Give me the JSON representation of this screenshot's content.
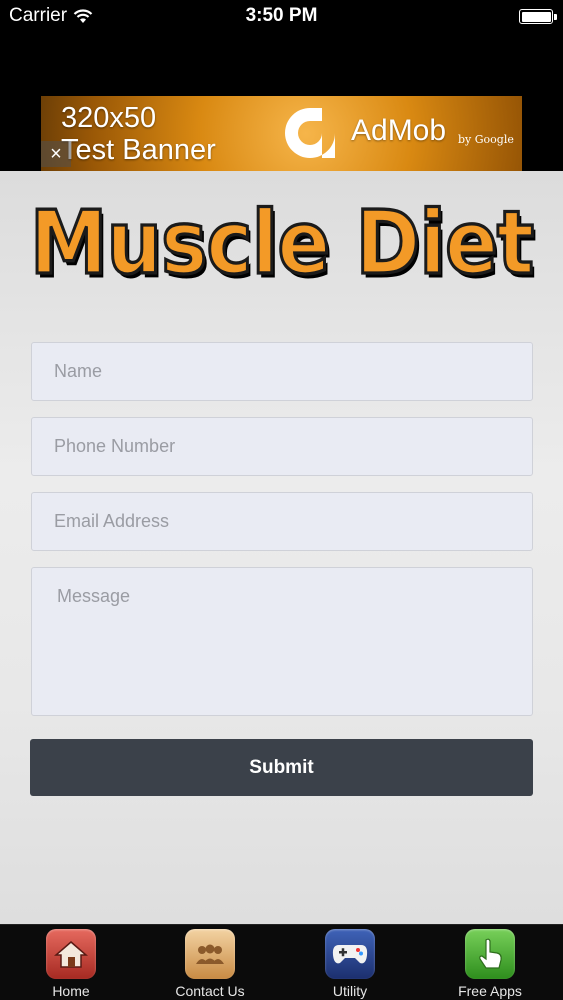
{
  "status_bar": {
    "carrier": "Carrier",
    "time": "3:50 PM",
    "battery_level": 1.0
  },
  "ad_banner": {
    "size_line1": "320x50",
    "size_line2": "Test Banner",
    "close_symbol": "×",
    "brand": "AdMob",
    "by": "by Google"
  },
  "app": {
    "logo_text": "Muscle Diet"
  },
  "form": {
    "name_placeholder": "Name",
    "phone_placeholder": "Phone Number",
    "email_placeholder": "Email Address",
    "message_placeholder": "Message",
    "submit_label": "Submit"
  },
  "tabs": [
    {
      "label": "Home",
      "icon": "home-icon"
    },
    {
      "label": "Contact Us",
      "icon": "people-icon"
    },
    {
      "label": "Utility",
      "icon": "gamepad-icon"
    },
    {
      "label": "Free Apps",
      "icon": "pointing-hand-icon"
    }
  ],
  "colors": {
    "submit_bg": "#3b414a",
    "logo_orange": "#f39a27",
    "ad_orange": "#d98912"
  }
}
